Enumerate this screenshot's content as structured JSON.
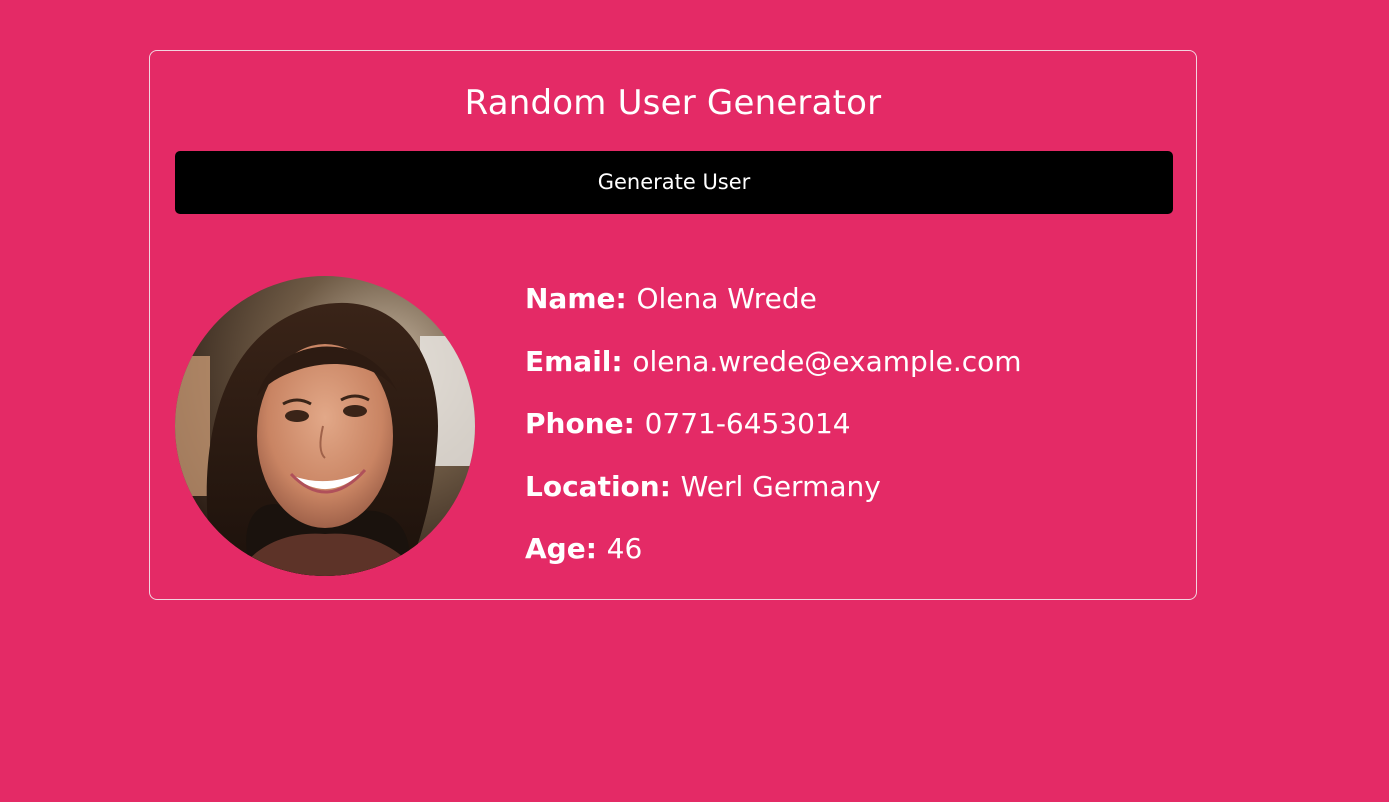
{
  "app": {
    "title": "Random User Generator",
    "generate_label": "Generate User"
  },
  "user": {
    "avatar_alt": "user-photo",
    "fields": [
      {
        "label": "Name:",
        "value": "Olena Wrede"
      },
      {
        "label": "Email:",
        "value": "olena.wrede@example.com"
      },
      {
        "label": "Phone:",
        "value": "0771-6453014"
      },
      {
        "label": "Location:",
        "value": "Werl Germany"
      },
      {
        "label": "Age:",
        "value": "46"
      }
    ]
  },
  "colors": {
    "background": "#e42a66",
    "button": "#000000",
    "text": "#ffffff",
    "card_border": "#f2d4df"
  }
}
